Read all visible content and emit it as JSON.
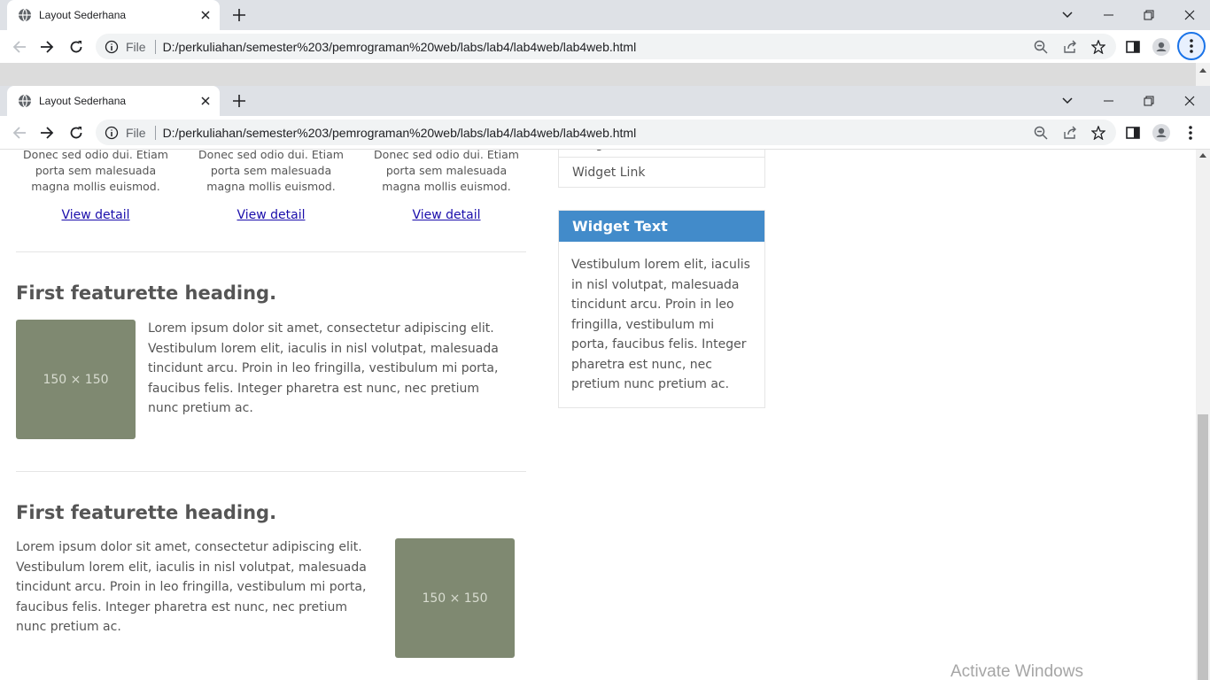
{
  "browser": {
    "tab_title": "Layout Sederhana",
    "file_label": "File",
    "url": "D:/perkuliahan/semester%203/pemrograman%20web/labs/lab4/lab4web/lab4web.html"
  },
  "columns": [
    {
      "text": "Donec sed odio dui. Etiam porta sem malesuada magna mollis euismod.",
      "link": "View detail"
    },
    {
      "text": "Donec sed odio dui. Etiam porta sem malesuada magna mollis euismod.",
      "link": "View detail"
    },
    {
      "text": "Donec sed odio dui. Etiam porta sem malesuada magna mollis euismod.",
      "link": "View detail"
    }
  ],
  "featurettes": [
    {
      "heading": "First featurette heading.",
      "placeholder": "150 × 150",
      "text": "Lorem ipsum dolor sit amet, consectetur adipiscing elit. Vestibulum lorem elit, iaculis in nisl volutpat, malesuada tincidunt arcu. Proin in leo fringilla, vestibulum mi porta, faucibus felis. Integer pharetra est nunc, nec pretium nunc pretium ac."
    },
    {
      "heading": "First featurette heading.",
      "placeholder": "150 × 150",
      "text": "Lorem ipsum dolor sit amet, consectetur adipiscing elit. Vestibulum lorem elit, iaculis in nisl volutpat, malesuada tincidunt arcu. Proin in leo fringilla, vestibulum mi porta, faucibus felis. Integer pharetra est nunc, nec pretium nunc pretium ac."
    }
  ],
  "sidebar": {
    "links": [
      "Widget Link",
      "Widget Link"
    ],
    "widget_text_title": "Widget Text",
    "widget_text_body": "Vestibulum lorem elit, iaculis in nisl volutpat, malesuada tincidunt arcu. Proin in leo fringilla, vestibulum mi porta, faucibus felis. Integer pharetra est nunc, nec pretium nunc pretium ac."
  },
  "watermark": "Activate Windows",
  "colors": {
    "placeholder": "#7f8971",
    "widget_header": "#428bca",
    "link": "#1a0dab",
    "accent_focus": "#1a73e8"
  }
}
